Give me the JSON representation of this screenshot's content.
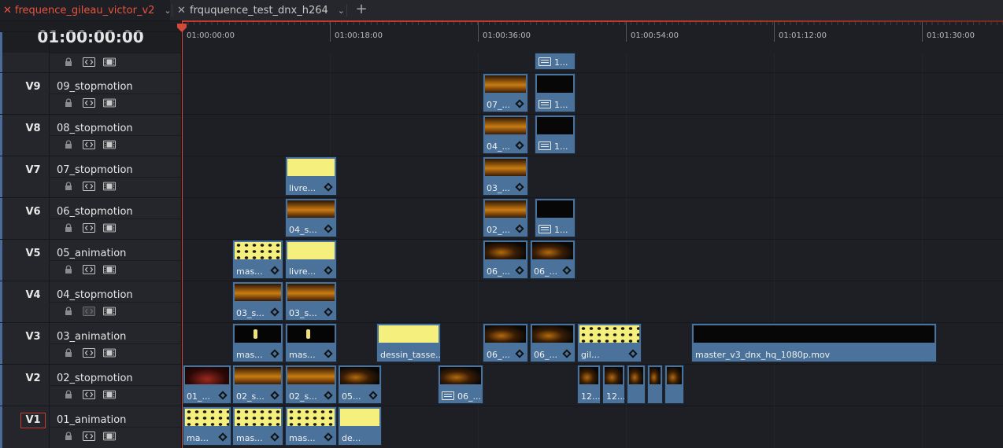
{
  "tabs": [
    {
      "label": "frequence_gileau_victor_v2",
      "active": true
    },
    {
      "label": "frququence_test_dnx_h264",
      "active": false
    }
  ],
  "timecode": "01:00:00:00",
  "ruler": {
    "labels": [
      "01:00:00:00",
      "01:00:18:00",
      "01:00:36:00",
      "01:00:54:00",
      "01:01:12:00",
      "01:01:30:00"
    ]
  },
  "tracks": [
    {
      "id": "V9",
      "name": "09_stopmotion"
    },
    {
      "id": "V8",
      "name": "08_stopmotion"
    },
    {
      "id": "V7",
      "name": "07_stopmotion"
    },
    {
      "id": "V6",
      "name": "06_stopmotion"
    },
    {
      "id": "V5",
      "name": "05_animation"
    },
    {
      "id": "V4",
      "name": "04_stopmotion"
    },
    {
      "id": "V3",
      "name": "03_animation"
    },
    {
      "id": "V2",
      "name": "02_stopmotion"
    },
    {
      "id": "V1",
      "name": "01_animation"
    }
  ],
  "clips": {
    "v10_a": "1...",
    "v9_a": "07_...",
    "v9_b": "1...",
    "v8_a": "04_...",
    "v8_b": "1...",
    "v7_a": "livre...",
    "v7_b": "03_...",
    "v6_a": "04_s...",
    "v6_b": "02_...",
    "v6_c": "1...",
    "v5_a": "mas...",
    "v5_b": "livre...",
    "v5_c": "06_...",
    "v5_d": "06_...",
    "v4_a": "03_s...",
    "v4_b": "03_s...",
    "v3_a": "mas...",
    "v3_b": "mas...",
    "v3_c": "dessin_tasse...",
    "v3_d": "06_...",
    "v3_e": "06_...",
    "v3_f": "gil...",
    "v3_g": "master_v3_dnx_hq_1080p.mov",
    "v2_a": "01_...",
    "v2_b": "02_s...",
    "v2_c": "02_s...",
    "v2_d": "05...",
    "v2_e": "06_...",
    "v2_f": "12...",
    "v2_g": "12...",
    "v1_a": "ma...",
    "v1_b": "mas...",
    "v1_c": "mas...",
    "v1_d": "de..."
  },
  "colors": {
    "active_tab": "#e9543c",
    "playhead": "#d44a3a",
    "clip": "#4a729a",
    "v1_border": "#c73b2e"
  }
}
